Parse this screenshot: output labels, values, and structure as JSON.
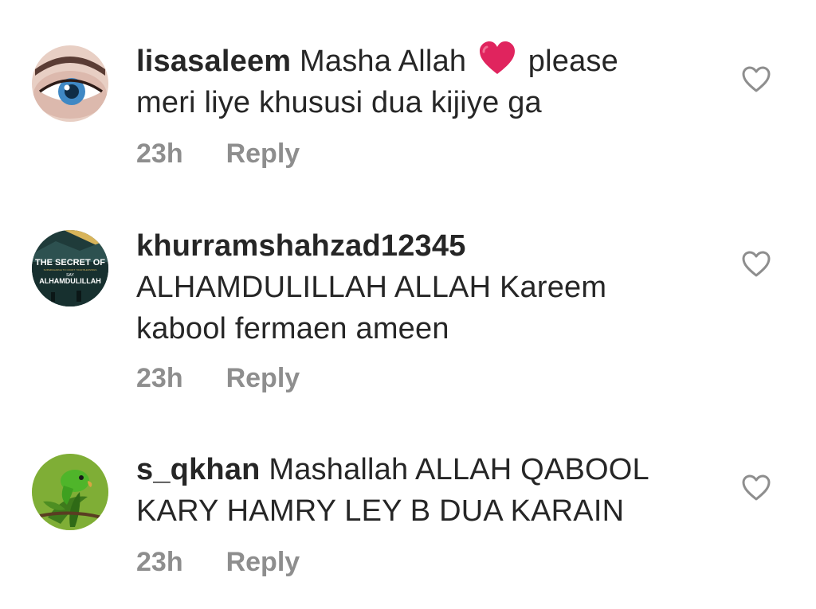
{
  "comments": [
    {
      "username": "lisasaleem",
      "text_before": "Masha Allah",
      "text_after": "please",
      "line2": "meri liye khususi dua kijiye ga",
      "time": "23h",
      "reply_label": "Reply",
      "emoji": "red-heart-emoji"
    },
    {
      "username": "khurramshahzad12345",
      "line1": "ALHAMDULILLAH ALLAH Kareem",
      "line2": "kabool fermaen ameen",
      "time": "23h",
      "reply_label": "Reply",
      "avatar_text": {
        "top": "THE SECRET OF",
        "small": "SUPERCHARGE TO COUNT YOUR BLESSINGS",
        "say": "SAY",
        "bottom": "ALHAMDULILLAH"
      }
    },
    {
      "username": "s_qkhan",
      "text_first": "Mashallah ALLAH QABOOL",
      "line2": "KARY HAMRY LEY B DUA KARAIN",
      "time": "23h",
      "reply_label": "Reply"
    }
  ],
  "colors": {
    "text": "#262626",
    "meta": "#8e8e8e",
    "heart_emoji": "#e0245e",
    "like_outline": "#8e8e8e"
  },
  "icons": {
    "like": "heart-outline-icon"
  }
}
